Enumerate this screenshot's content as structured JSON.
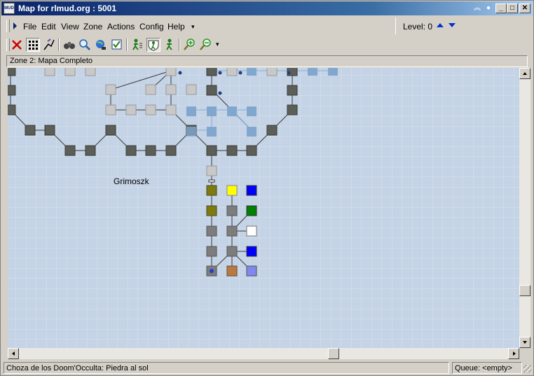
{
  "window": {
    "title": "Map for rlmud.org : 5001",
    "app_icon_text": "MUD",
    "extra_buttons": [
      "︽",
      "●"
    ],
    "caption_buttons": [
      "_",
      "□",
      "✕"
    ]
  },
  "menu": {
    "items": [
      "File",
      "Edit",
      "View",
      "Zone",
      "Actions",
      "Config",
      "Help"
    ],
    "overflow": "▾"
  },
  "level": {
    "label": "Level: 0"
  },
  "toolbar": {
    "buttons": [
      "delete-icon",
      "select-mode-icon",
      "path-mode-icon",
      "binoculars-icon",
      "find-icon",
      "globe-icon",
      "checkbox-icon",
      "walk-icon",
      "shield-walk-icon",
      "speedwalk-icon",
      "zoom-in-icon",
      "zoom-out-icon"
    ],
    "overflow": "▾"
  },
  "zone": {
    "label": "Zone 2: Mapa Completo"
  },
  "map": {
    "background": "#c4d3e5",
    "grid_color": "#d8e3ef",
    "room_colors": {
      "dark": "#5b5f57",
      "light": "#c8c8c8",
      "blue": "#82a7cf",
      "mid": "#7d7d7d",
      "olive": "#7e7a0e",
      "yellow": "#ffff00",
      "navy": "#0000ff",
      "green": "#008000",
      "white": "#ffffff",
      "brown": "#b87a42",
      "lavender": "#7f88ec"
    },
    "zone_label": "Grimoszk"
  },
  "status": {
    "room": "Choza de los Doom'Occulta: Piedra al sol",
    "queue": "Queue:  <empty>"
  }
}
